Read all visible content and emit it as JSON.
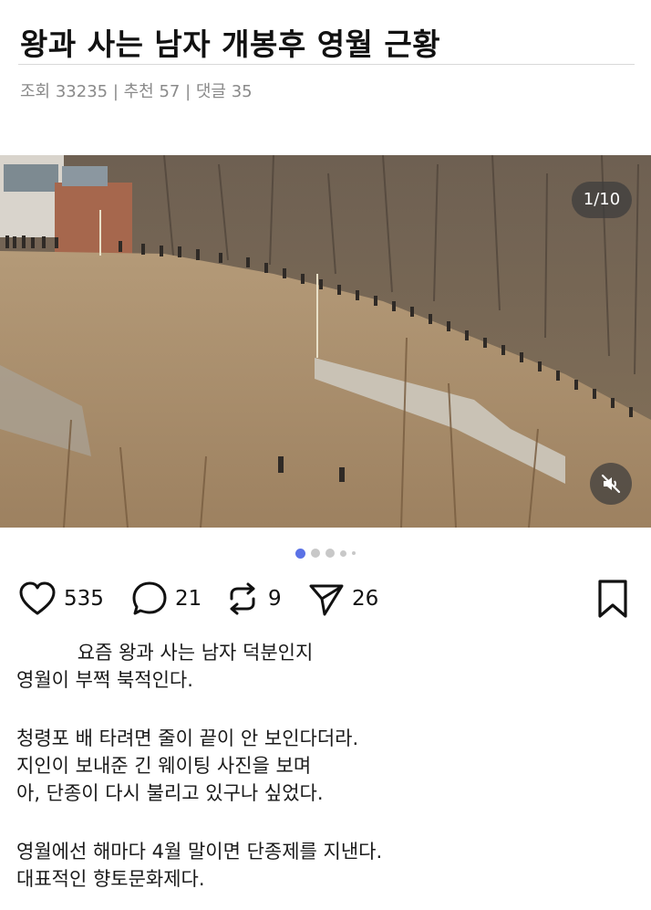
{
  "post": {
    "title": "왕과 사는 남자 개봉후 영월 근황",
    "meta": "조회 33235 | 추천 57 | 댓글 35"
  },
  "media": {
    "counter": "1/10",
    "icons": {
      "mute": "volume-mute-icon"
    }
  },
  "carousel": {
    "dot_count": 5,
    "active_index": 0,
    "active_color": "#5b72e6"
  },
  "actions": {
    "like_count": "535",
    "comment_count": "21",
    "repost_count": "9",
    "share_count": "26",
    "icons": [
      "heart-icon",
      "comment-icon",
      "repost-icon",
      "send-icon",
      "bookmark-icon"
    ]
  },
  "content": {
    "lines": [
      "          요즘 왕과 사는 남자 덕분인지",
      "영월이 부쩍 북적인다.",
      "",
      "청령포 배 타려면 줄이 끝이 안 보인다더라.",
      "지인이 보내준 긴 웨이팅 사진을 보며",
      "아, 단종이 다시 불리고 있구나 싶었다.",
      "",
      "영월에선 해마다 4월 말이면 단종제를 지낸다.",
      "대표적인 향토문화제다."
    ]
  }
}
